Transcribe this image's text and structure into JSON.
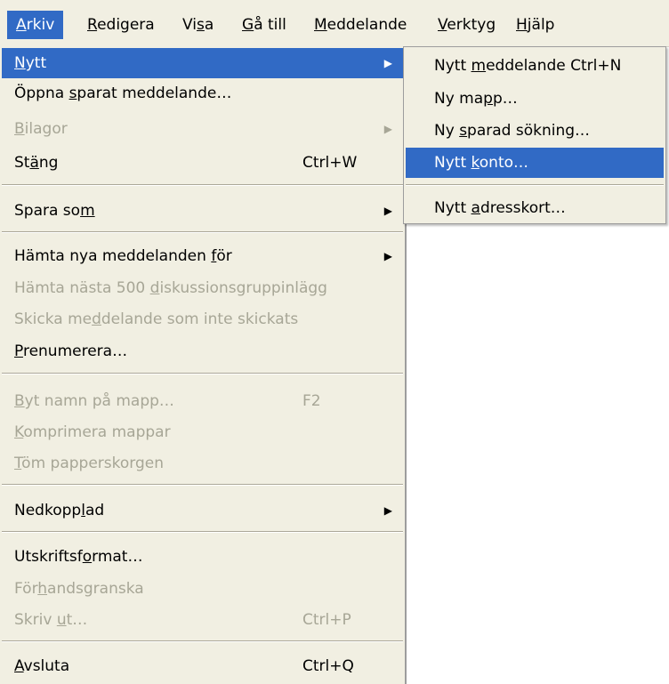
{
  "menubar": {
    "items": [
      {
        "pre": "",
        "key": "A",
        "post": "rkiv"
      },
      {
        "pre": "",
        "key": "R",
        "post": "edigera"
      },
      {
        "pre": "Vi",
        "key": "s",
        "post": "a"
      },
      {
        "pre": "",
        "key": "G",
        "post": "å till"
      },
      {
        "pre": "",
        "key": "M",
        "post": "eddelande"
      },
      {
        "pre": "",
        "key": "V",
        "post": "erktyg"
      },
      {
        "pre": "",
        "key": "H",
        "post": "jälp"
      }
    ]
  },
  "menu": {
    "items": [
      {
        "pre": "",
        "key": "N",
        "post": "ytt",
        "shortcut": "",
        "arrow": "▶"
      },
      {
        "pre": "Öppna ",
        "key": "s",
        "post": "parat meddelande…",
        "shortcut": "",
        "arrow": ""
      },
      {
        "pre": "",
        "key": "B",
        "post": "ilagor",
        "shortcut": "",
        "arrow": "▶"
      },
      {
        "pre": "St",
        "key": "ä",
        "post": "ng",
        "shortcut": "Ctrl+W",
        "arrow": ""
      },
      {
        "pre": "Spara so",
        "key": "m",
        "post": "",
        "shortcut": "",
        "arrow": "▶"
      },
      {
        "pre": "Hämta nya meddelanden ",
        "key": "f",
        "post": "ör",
        "shortcut": "",
        "arrow": "▶"
      },
      {
        "pre": "Hämta nästa 500 ",
        "key": "d",
        "post": "iskussionsgruppinlägg",
        "shortcut": "",
        "arrow": ""
      },
      {
        "pre": "Skicka me",
        "key": "d",
        "post": "delande som inte skickats",
        "shortcut": "",
        "arrow": ""
      },
      {
        "pre": "",
        "key": "P",
        "post": "renumerera…",
        "shortcut": "",
        "arrow": ""
      },
      {
        "pre": "",
        "key": "B",
        "post": "yt namn på mapp…",
        "shortcut": "F2",
        "arrow": ""
      },
      {
        "pre": "",
        "key": "K",
        "post": "omprimera mappar",
        "shortcut": "",
        "arrow": ""
      },
      {
        "pre": "",
        "key": "T",
        "post": "öm papperskorgen",
        "shortcut": "",
        "arrow": ""
      },
      {
        "pre": "Nedkopp",
        "key": "l",
        "post": "ad",
        "shortcut": "",
        "arrow": "▶"
      },
      {
        "pre": "Utskriftsf",
        "key": "o",
        "post": "rmat…",
        "shortcut": "",
        "arrow": ""
      },
      {
        "pre": "För",
        "key": "h",
        "post": "andsgranska",
        "shortcut": "",
        "arrow": ""
      },
      {
        "pre": "Skriv ",
        "key": "u",
        "post": "t…",
        "shortcut": "Ctrl+P",
        "arrow": ""
      },
      {
        "pre": "",
        "key": "A",
        "post": "vsluta",
        "shortcut": "Ctrl+Q",
        "arrow": ""
      }
    ]
  },
  "submenu": {
    "items": [
      {
        "pre": "Nytt ",
        "key": "m",
        "post": "eddelande Ctrl+N"
      },
      {
        "pre": "Ny ma",
        "key": "p",
        "post": "p…"
      },
      {
        "pre": "Ny ",
        "key": "s",
        "post": "parad sökning…"
      },
      {
        "pre": "Nytt ",
        "key": "k",
        "post": "onto…"
      },
      {
        "pre": "Nytt ",
        "key": "a",
        "post": "dresskort…"
      }
    ]
  },
  "colors": {
    "menu_bg": "#f1efe2",
    "highlight": "#316ac5",
    "disabled_text": "#a7a696"
  }
}
